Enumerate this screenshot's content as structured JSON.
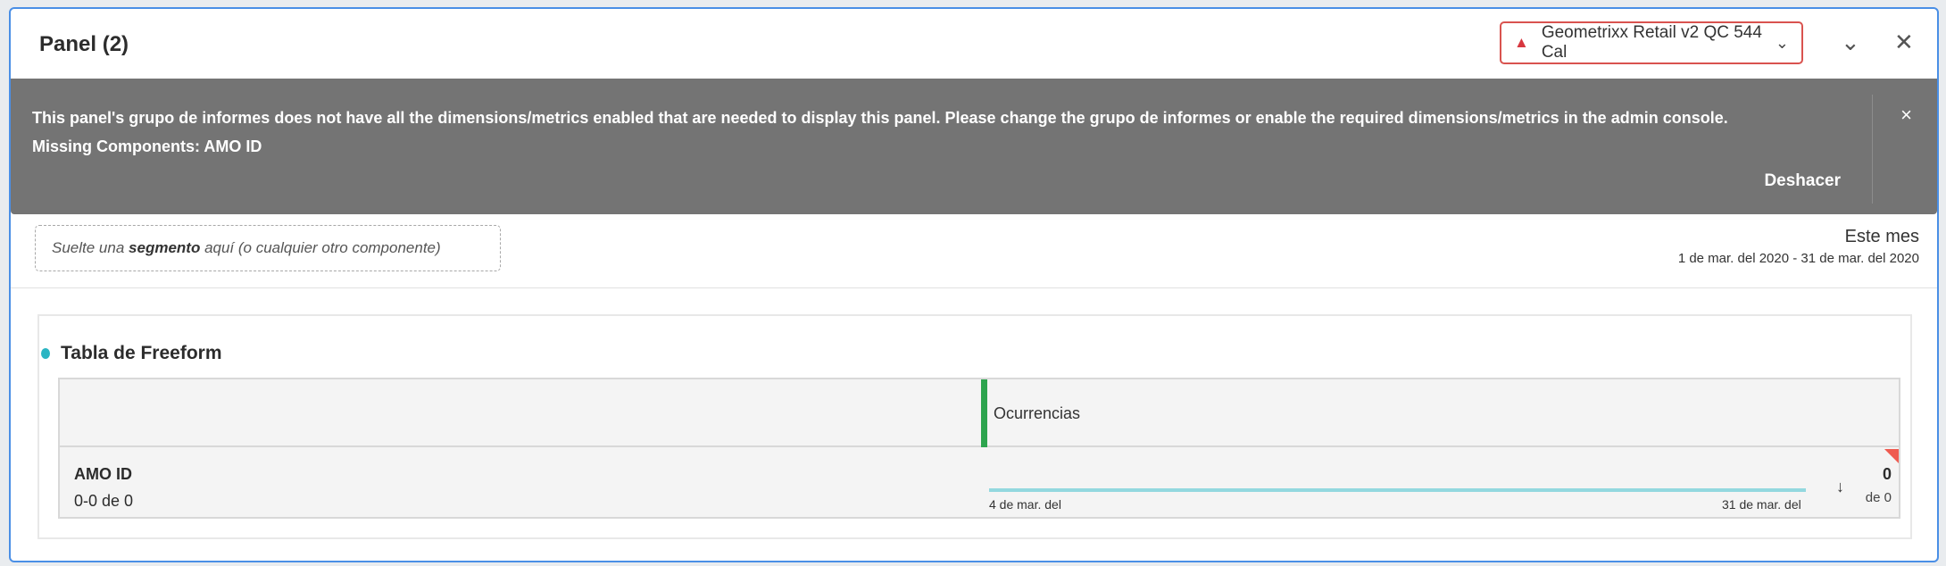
{
  "panel": {
    "title": "Panel (2)",
    "report_suite": "Geometrixx Retail v2 QC 544 Cal"
  },
  "banner": {
    "message": "This panel's grupo de informes does not have all the dimensions/metrics enabled that are needed to display this panel. Please change the grupo de informes or enable the required dimensions/metrics in the admin console.",
    "missing": "Missing Components: AMO ID",
    "undo": "Deshacer",
    "close": "×"
  },
  "dropzone": {
    "pre": "Suelte una ",
    "bold": "segmento",
    "post": " aquí (o cualquier otro componente)"
  },
  "date_range": {
    "label": "Este mes",
    "range": "1 de mar. del 2020 - 31 de mar. del 2020"
  },
  "table": {
    "title": "Tabla de Freeform",
    "metric": "Ocurrencias",
    "dimension": "AMO ID",
    "row_count": "0-0 de 0",
    "spark_start": "4 de mar. del",
    "spark_end": "31 de mar. del",
    "total": "0",
    "total_of": "de 0"
  },
  "colors": {
    "accent": "#2bb5c3",
    "error": "#d7373f",
    "metric_bar": "#2da44e"
  }
}
